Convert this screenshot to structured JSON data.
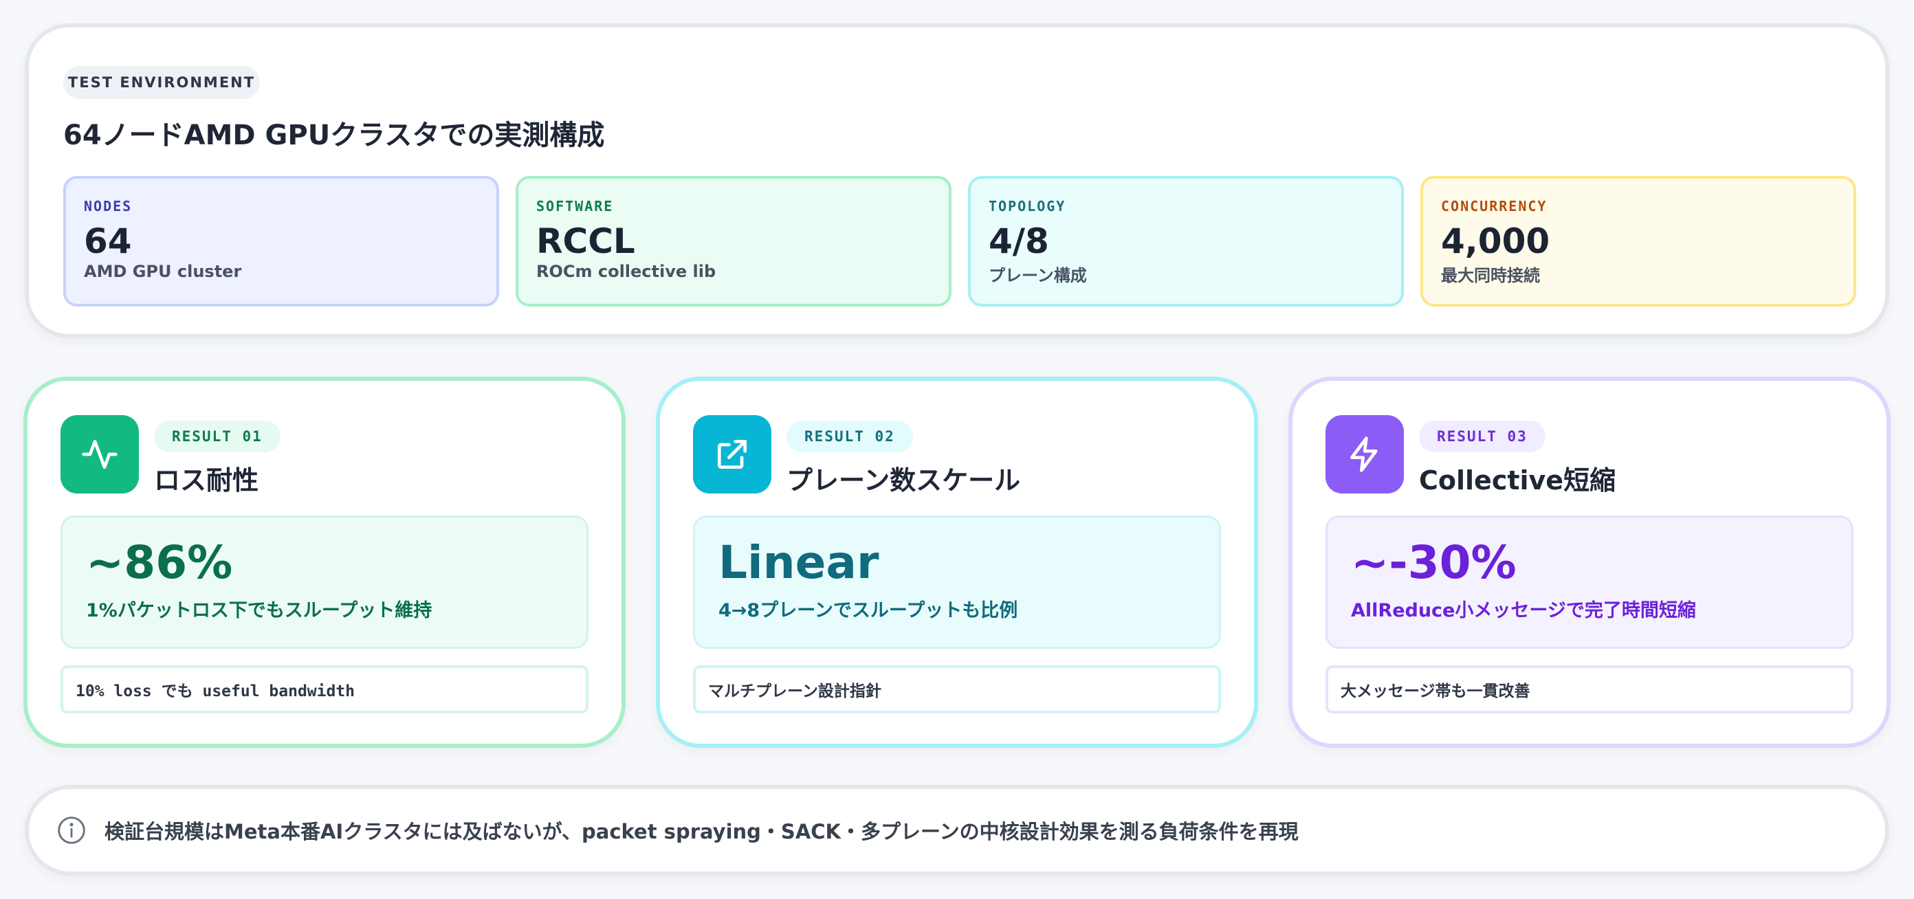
{
  "environment": {
    "badge": "TEST ENVIRONMENT",
    "title": "64ノードAMD GPUクラスタでの実測構成",
    "stats": [
      {
        "label": "NODES",
        "value": "64",
        "sub": "AMD GPU cluster"
      },
      {
        "label": "SOFTWARE",
        "value": "RCCL",
        "sub": "ROCm collective lib"
      },
      {
        "label": "TOPOLOGY",
        "value": "4/8",
        "sub": "プレーン構成"
      },
      {
        "label": "CONCURRENCY",
        "value": "4,000",
        "sub": "最大同時接続"
      }
    ]
  },
  "results": [
    {
      "icon": "activity-icon",
      "badge": "RESULT 01",
      "title": "ロス耐性",
      "metric": "~86%",
      "desc": "1%パケットロス下でもスループット維持",
      "note": "10% loss でも useful bandwidth",
      "accent": "#12b981"
    },
    {
      "icon": "external-link-icon",
      "badge": "RESULT 02",
      "title": "プレーン数スケール",
      "metric": "Linear",
      "desc": "4→8プレーンでスループットも比例",
      "note": "マルチプレーン設計指針",
      "accent": "#06b6d4"
    },
    {
      "icon": "lightning-icon",
      "badge": "RESULT 03",
      "title": "Collective短縮",
      "metric": "~-30%",
      "desc": "AllReduce小メッセージで完了時間短縮",
      "note": "大メッセージ帯も一貫改善",
      "accent": "#8b5cf6"
    }
  ],
  "footer": {
    "icon": "info-icon",
    "text": "検証台規模はMeta本番AIクラスタには及ばないが、packet spraying・SACK・多プレーンの中核設計効果を測る負荷条件を再現"
  }
}
